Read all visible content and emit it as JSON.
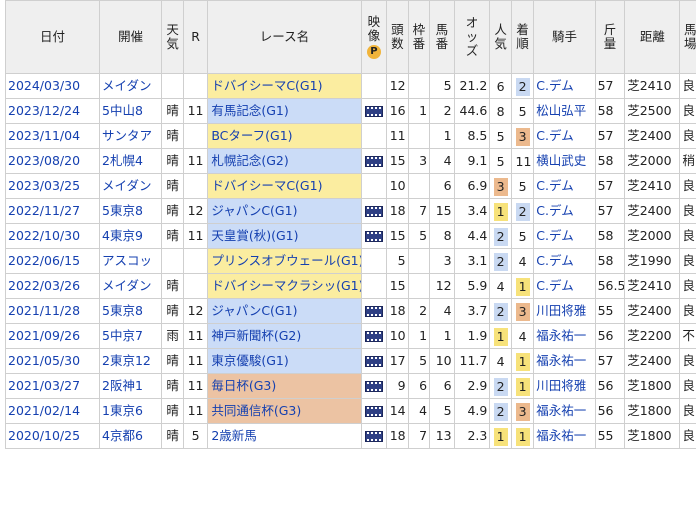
{
  "headers": {
    "date": "日付",
    "venue": "開催",
    "weather": "天気",
    "round": "R",
    "race": "レース名",
    "video": "映像",
    "video_badge": "P",
    "heads": "頭数",
    "gate": "枠番",
    "horse_no": "馬番",
    "odds": "オッズ",
    "pop": "人気",
    "finish": "着順",
    "jockey": "騎手",
    "weight": "斤量",
    "distance": "距離",
    "track": "馬場"
  },
  "rows": [
    {
      "date": "2024/03/30",
      "venue": "メイダン",
      "weather": "",
      "round": "",
      "race": "ドバイシーマC(G1)",
      "grade": "g1",
      "video": false,
      "heads": "12",
      "gate": "",
      "horse_no": "5",
      "odds": "21.2",
      "pop": "6",
      "finish": "2",
      "jockey": "C.デム",
      "weight": "57",
      "distance": "芝2410",
      "track": "良"
    },
    {
      "date": "2023/12/24",
      "venue": "5中山8",
      "weather": "晴",
      "round": "11",
      "race": "有馬記念(G1)",
      "grade": "g2",
      "video": true,
      "heads": "16",
      "gate": "1",
      "horse_no": "2",
      "odds": "44.6",
      "pop": "8",
      "finish": "5",
      "jockey": "松山弘平",
      "weight": "58",
      "distance": "芝2500",
      "track": "良"
    },
    {
      "date": "2023/11/04",
      "venue": "サンタア",
      "weather": "晴",
      "round": "",
      "race": "BCターフ(G1)",
      "grade": "g1",
      "video": false,
      "heads": "11",
      "gate": "",
      "horse_no": "1",
      "odds": "8.5",
      "pop": "5",
      "finish": "3",
      "jockey": "C.デム",
      "weight": "57",
      "distance": "芝2400",
      "track": "良"
    },
    {
      "date": "2023/08/20",
      "venue": "2札幌4",
      "weather": "晴",
      "round": "11",
      "race": "札幌記念(G2)",
      "grade": "g2",
      "video": true,
      "heads": "15",
      "gate": "3",
      "horse_no": "4",
      "odds": "9.1",
      "pop": "5",
      "finish": "11",
      "jockey": "横山武史",
      "weight": "58",
      "distance": "芝2000",
      "track": "稍"
    },
    {
      "date": "2023/03/25",
      "venue": "メイダン",
      "weather": "晴",
      "round": "",
      "race": "ドバイシーマC(G1)",
      "grade": "g1",
      "video": false,
      "heads": "10",
      "gate": "",
      "horse_no": "6",
      "odds": "6.9",
      "pop": "3",
      "finish": "5",
      "jockey": "C.デム",
      "weight": "57",
      "distance": "芝2410",
      "track": "良"
    },
    {
      "date": "2022/11/27",
      "venue": "5東京8",
      "weather": "晴",
      "round": "12",
      "race": "ジャパンC(G1)",
      "grade": "g2",
      "video": true,
      "heads": "18",
      "gate": "7",
      "horse_no": "15",
      "odds": "3.4",
      "pop": "1",
      "finish": "2",
      "jockey": "C.デム",
      "weight": "57",
      "distance": "芝2400",
      "track": "良"
    },
    {
      "date": "2022/10/30",
      "venue": "4東京9",
      "weather": "晴",
      "round": "11",
      "race": "天皇賞(秋)(G1)",
      "grade": "g2",
      "video": true,
      "heads": "15",
      "gate": "5",
      "horse_no": "8",
      "odds": "4.4",
      "pop": "2",
      "finish": "5",
      "jockey": "C.デム",
      "weight": "58",
      "distance": "芝2000",
      "track": "良"
    },
    {
      "date": "2022/06/15",
      "venue": "アスコッ",
      "weather": "",
      "round": "",
      "race": "プリンスオブウェール(G1)",
      "grade": "g1",
      "video": false,
      "heads": "5",
      "gate": "",
      "horse_no": "3",
      "odds": "3.1",
      "pop": "2",
      "finish": "4",
      "jockey": "C.デム",
      "weight": "58",
      "distance": "芝1990",
      "track": "良"
    },
    {
      "date": "2022/03/26",
      "venue": "メイダン",
      "weather": "晴",
      "round": "",
      "race": "ドバイシーマクラシッ(G1)",
      "grade": "g1",
      "video": false,
      "heads": "15",
      "gate": "",
      "horse_no": "12",
      "odds": "5.9",
      "pop": "4",
      "finish": "1",
      "jockey": "C.デム",
      "weight": "56.5",
      "distance": "芝2410",
      "track": "良"
    },
    {
      "date": "2021/11/28",
      "venue": "5東京8",
      "weather": "晴",
      "round": "12",
      "race": "ジャパンC(G1)",
      "grade": "g2",
      "video": true,
      "heads": "18",
      "gate": "2",
      "horse_no": "4",
      "odds": "3.7",
      "pop": "2",
      "finish": "3",
      "jockey": "川田将雅",
      "weight": "55",
      "distance": "芝2400",
      "track": "良"
    },
    {
      "date": "2021/09/26",
      "venue": "5中京7",
      "weather": "雨",
      "round": "11",
      "race": "神戸新聞杯(G2)",
      "grade": "g2",
      "video": true,
      "heads": "10",
      "gate": "1",
      "horse_no": "1",
      "odds": "1.9",
      "pop": "1",
      "finish": "4",
      "jockey": "福永祐一",
      "weight": "56",
      "distance": "芝2200",
      "track": "不"
    },
    {
      "date": "2021/05/30",
      "venue": "2東京12",
      "weather": "晴",
      "round": "11",
      "race": "東京優駿(G1)",
      "grade": "g2",
      "video": true,
      "heads": "17",
      "gate": "5",
      "horse_no": "10",
      "odds": "11.7",
      "pop": "4",
      "finish": "1",
      "jockey": "福永祐一",
      "weight": "57",
      "distance": "芝2400",
      "track": "良"
    },
    {
      "date": "2021/03/27",
      "venue": "2阪神1",
      "weather": "晴",
      "round": "11",
      "race": "毎日杯(G3)",
      "grade": "g3",
      "video": true,
      "heads": "9",
      "gate": "6",
      "horse_no": "6",
      "odds": "2.9",
      "pop": "2",
      "finish": "1",
      "jockey": "川田将雅",
      "weight": "56",
      "distance": "芝1800",
      "track": "良"
    },
    {
      "date": "2021/02/14",
      "venue": "1東京6",
      "weather": "晴",
      "round": "11",
      "race": "共同通信杯(G3)",
      "grade": "g3",
      "video": true,
      "heads": "14",
      "gate": "4",
      "horse_no": "5",
      "odds": "4.9",
      "pop": "2",
      "finish": "3",
      "jockey": "福永祐一",
      "weight": "56",
      "distance": "芝1800",
      "track": "良"
    },
    {
      "date": "2020/10/25",
      "venue": "4京都6",
      "weather": "晴",
      "round": "5",
      "race": "2歳新馬",
      "grade": "none",
      "video": true,
      "heads": "18",
      "gate": "7",
      "horse_no": "13",
      "odds": "2.3",
      "pop": "1",
      "finish": "1",
      "jockey": "福永祐一",
      "weight": "55",
      "distance": "芝1800",
      "track": "良"
    }
  ]
}
